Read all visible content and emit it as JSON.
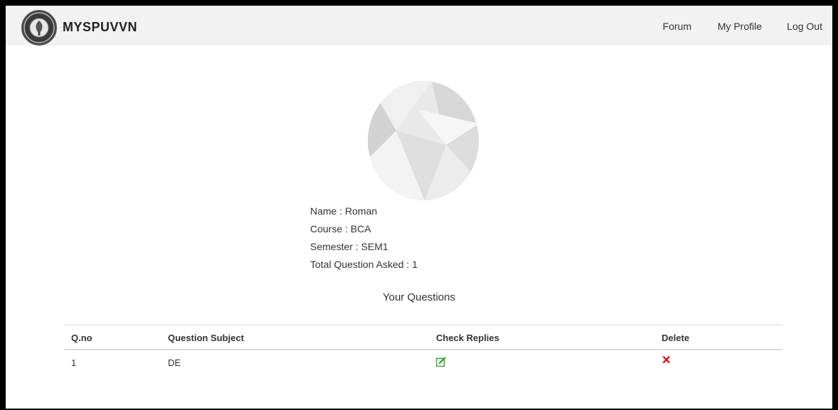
{
  "navbar": {
    "brand": "MYSPUVVN",
    "links": [
      "Forum",
      "My Profile",
      "Log Out"
    ]
  },
  "profile": {
    "name_line": "Name : Roman",
    "course_line": "Course : BCA",
    "semester_line": "Semester : SEM1",
    "total_line": "Total Question Asked : 1"
  },
  "questions": {
    "title": "Your Questions",
    "headers": [
      "Q.no",
      "Question Subject",
      "Check Replies",
      "Delete"
    ],
    "rows": [
      {
        "qno": "1",
        "subject": "DE"
      }
    ]
  },
  "icons": {
    "edit": "edit-icon",
    "delete": "close-icon",
    "logo": "university-logo"
  },
  "colors": {
    "edit_green": "#2aa52a",
    "delete_red": "#e00000",
    "navbar_bg": "#f2f2f2"
  }
}
